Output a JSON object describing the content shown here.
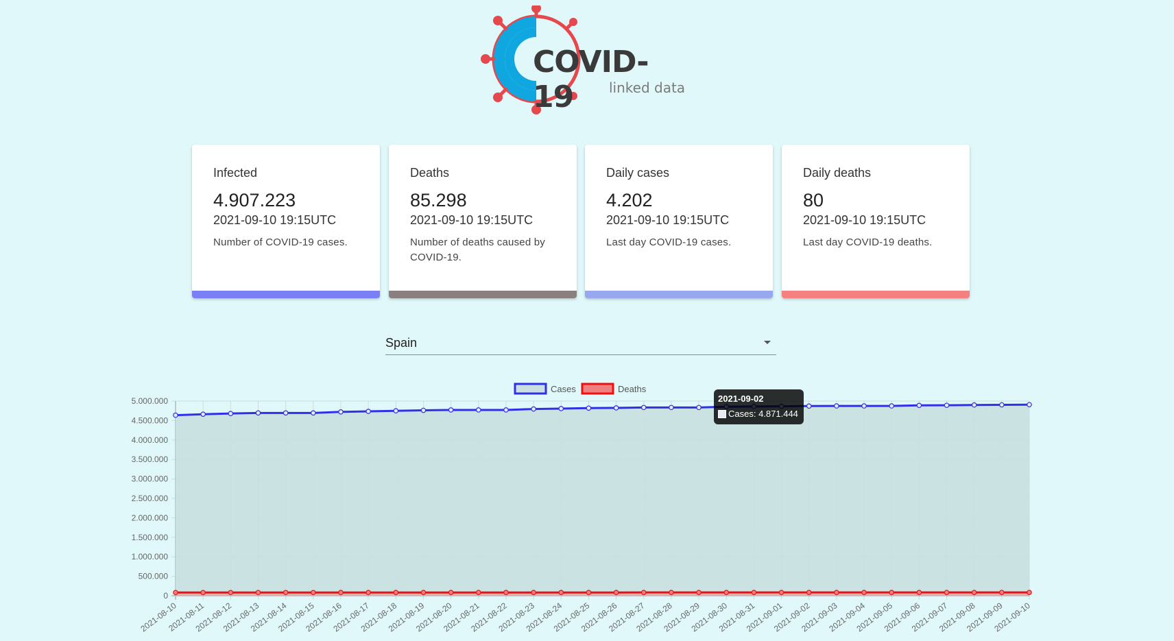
{
  "logo": {
    "title": "COVID-19",
    "subtitle": "linked data"
  },
  "cards": [
    {
      "title": "Infected",
      "value": "4.907.223",
      "time": "2021-09-10 19:15UTC",
      "description": "Number of COVID-19 cases.",
      "color": "#7b7ff5"
    },
    {
      "title": "Deaths",
      "value": "85.298",
      "time": "2021-09-10 19:15UTC",
      "description": "Number of deaths caused by COVID-19.",
      "color": "#8b8080"
    },
    {
      "title": "Daily cases",
      "value": "4.202",
      "time": "2021-09-10 19:15UTC",
      "description": "Last day COVID-19 cases.",
      "color": "#98a8ee"
    },
    {
      "title": "Daily deaths",
      "value": "80",
      "time": "2021-09-10 19:15UTC",
      "description": "Last day COVID-19 deaths.",
      "color": "#f58080"
    }
  ],
  "country_select": {
    "value": "Spain"
  },
  "tooltip": {
    "title": "2021-09-02",
    "body": "Cases: 4.871.444"
  },
  "chart_data": {
    "type": "line",
    "title": "",
    "xlabel": "",
    "ylabel": "",
    "ylim": [
      0,
      5000000
    ],
    "y_ticks": [
      "0",
      "500.000",
      "1.000.000",
      "1.500.000",
      "2.000.000",
      "2.500.000",
      "3.000.000",
      "3.500.000",
      "4.000.000",
      "4.500.000",
      "5.000.000"
    ],
    "grid": true,
    "legend_position": "top",
    "categories": [
      "2021-08-10",
      "2021-08-11",
      "2021-08-12",
      "2021-08-13",
      "2021-08-14",
      "2021-08-15",
      "2021-08-16",
      "2021-08-17",
      "2021-08-18",
      "2021-08-19",
      "2021-08-20",
      "2021-08-21",
      "2021-08-22",
      "2021-08-23",
      "2021-08-24",
      "2021-08-25",
      "2021-08-26",
      "2021-08-27",
      "2021-08-28",
      "2021-08-29",
      "2021-08-30",
      "2021-08-31",
      "2021-09-01",
      "2021-09-02",
      "2021-09-03",
      "2021-09-04",
      "2021-09-05",
      "2021-09-06",
      "2021-09-07",
      "2021-09-08",
      "2021-09-09",
      "2021-09-10"
    ],
    "series": [
      {
        "name": "Cases",
        "color": "#3030e8",
        "fill": "#c9dfe0",
        "values": [
          4637000,
          4662000,
          4680000,
          4695000,
          4695000,
          4695000,
          4722000,
          4735000,
          4750000,
          4762000,
          4772000,
          4772000,
          4772000,
          4796000,
          4807000,
          4819000,
          4825000,
          4835000,
          4835000,
          4835000,
          4855000,
          4862000,
          4866000,
          4871444,
          4875000,
          4875000,
          4875000,
          4889000,
          4892000,
          4899000,
          4903000,
          4907223
        ]
      },
      {
        "name": "Deaths",
        "color": "#ee1010",
        "fill": "#f08080",
        "values": [
          83500,
          83600,
          83700,
          83800,
          83800,
          83800,
          83900,
          84000,
          84100,
          84200,
          84300,
          84300,
          84300,
          84400,
          84500,
          84600,
          84700,
          84750,
          84750,
          84750,
          84850,
          84900,
          84950,
          85000,
          85050,
          85050,
          85050,
          85120,
          85180,
          85220,
          85260,
          85298
        ]
      }
    ]
  }
}
